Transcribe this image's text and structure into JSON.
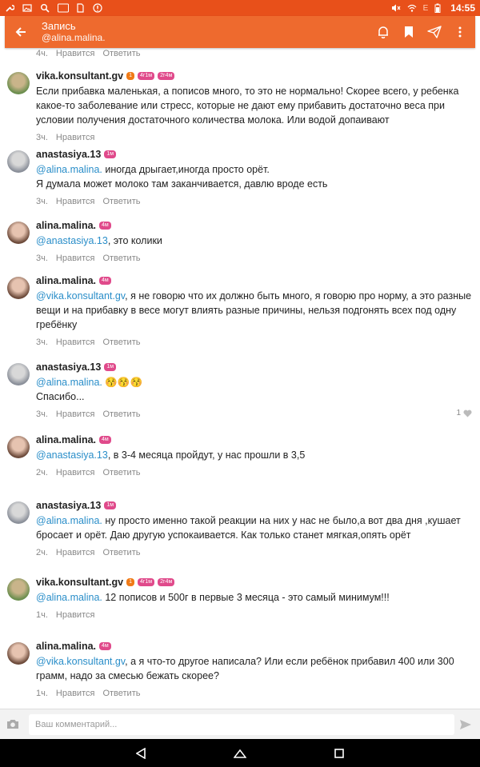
{
  "statusbar": {
    "time": "14:55",
    "battery_label": "E"
  },
  "appbar": {
    "title": "Запись",
    "subtitle": "@alina.malina."
  },
  "top_meta": {
    "time": "4ч.",
    "like": "Нравится",
    "reply": "Ответить"
  },
  "comments": [
    {
      "author": "vika.konsultant.gv",
      "badges": [
        {
          "text": "1",
          "color": "#f07a16"
        },
        {
          "text": "4г1м",
          "color": "#e04a8b"
        },
        {
          "text": "2г4м",
          "color": "#e04a8b"
        }
      ],
      "mention": "",
      "text": "Если прибавка маленькая, а пописов много, то это не нормально! Скорее всего, у ребенка какое-то заболевание или стресс, которые не дают ему прибавить достаточно веса при условии получения достаточного количества молока. Или водой допаивают",
      "time": "3ч.",
      "like": "Нравится",
      "reply": "",
      "likes": ""
    },
    {
      "author": "anastasiya.13",
      "badges": [
        {
          "text": "1м",
          "color": "#e04a8b"
        }
      ],
      "mention": "@alina.malina.",
      "text": " иногда дрыгает,иногда просто орёт.\nЯ думала может молоко там заканчивается, давлю вроде есть",
      "time": "3ч.",
      "like": "Нравится",
      "reply": "Ответить",
      "likes": ""
    },
    {
      "author": "alina.malina.",
      "badges": [
        {
          "text": "4м",
          "color": "#e04a8b"
        }
      ],
      "mention": "@anastasiya.13",
      "text": ", это колики",
      "time": "3ч.",
      "like": "Нравится",
      "reply": "Ответить",
      "likes": ""
    },
    {
      "author": "alina.malina.",
      "badges": [
        {
          "text": "4м",
          "color": "#e04a8b"
        }
      ],
      "mention": "@vika.konsultant.gv",
      "text": ", я не говорю что их должно быть много, я говорю про норму, а это разные вещи и на прибавку в весе могут влиять разные причины, нельзя подгонять всех под одну гребёнку",
      "time": "3ч.",
      "like": "Нравится",
      "reply": "Ответить",
      "likes": ""
    },
    {
      "author": "anastasiya.13",
      "badges": [
        {
          "text": "1м",
          "color": "#e04a8b"
        }
      ],
      "mention": "@alina.malina.",
      "text": " 😚😚😚\nСпасибо...",
      "time": "3ч.",
      "like": "Нравится",
      "reply": "Ответить",
      "likes": "1"
    },
    {
      "author": "alina.malina.",
      "badges": [
        {
          "text": "4м",
          "color": "#e04a8b"
        }
      ],
      "mention": "@anastasiya.13",
      "text": ", в 3-4 месяца пройдут, у нас прошли в 3,5",
      "time": "2ч.",
      "like": "Нравится",
      "reply": "Ответить",
      "likes": ""
    },
    {
      "author": "anastasiya.13",
      "badges": [
        {
          "text": "1м",
          "color": "#e04a8b"
        }
      ],
      "mention": "@alina.malina.",
      "text": " ну просто именно такой реакции на них у нас не было,а вот два дня ,кушает бросает и орёт. Даю другую успокаивается. Как только станет мягкая,опять орёт",
      "time": "2ч.",
      "like": "Нравится",
      "reply": "Ответить",
      "likes": ""
    },
    {
      "author": "vika.konsultant.gv",
      "badges": [
        {
          "text": "1",
          "color": "#f07a16"
        },
        {
          "text": "4г1м",
          "color": "#e04a8b"
        },
        {
          "text": "2г4м",
          "color": "#e04a8b"
        }
      ],
      "mention": "@alina.malina.",
      "text": " 12 пописов и 500г в первые 3 месяца - это самый минимум!!!",
      "time": "1ч.",
      "like": "Нравится",
      "reply": "",
      "likes": ""
    },
    {
      "author": "alina.malina.",
      "badges": [
        {
          "text": "4м",
          "color": "#e04a8b"
        }
      ],
      "mention": "@vika.konsultant.gv",
      "text": ", а я что-то другое написала? Или если ребёнок прибавил 400 или 300 грамм, надо за смесью бежать скорее?",
      "time": "1ч.",
      "like": "Нравится",
      "reply": "Ответить",
      "likes": ""
    }
  ],
  "input": {
    "placeholder": "Ваш комментарий..."
  },
  "colors": {
    "status_bar": "#e8501a",
    "app_bar": "#ee6a2e",
    "mention": "#2a8ec9",
    "badge_pink": "#e04a8b",
    "badge_orange": "#f07a16"
  }
}
